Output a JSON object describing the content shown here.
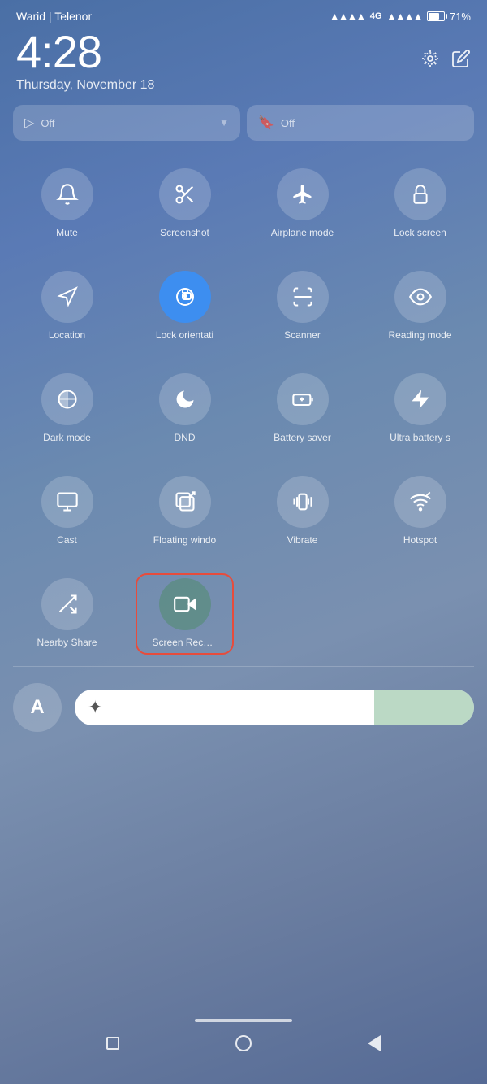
{
  "statusBar": {
    "carrier": "Warid | Telenor",
    "network": "4G",
    "batteryPercent": "71%"
  },
  "clock": {
    "time": "4:28",
    "date": "Thursday, November 18"
  },
  "quickTiles": [
    {
      "id": "location",
      "label": "Location",
      "icon": "location",
      "active": false
    },
    {
      "id": "lock-orientation",
      "label": "Lock orientati",
      "icon": "lock-rotate",
      "active": true
    },
    {
      "id": "scanner",
      "label": "Scanner",
      "icon": "scanner",
      "active": false
    },
    {
      "id": "reading-mode",
      "label": "Reading mode",
      "icon": "eye",
      "active": false
    },
    {
      "id": "dark-mode",
      "label": "Dark mode",
      "icon": "dark",
      "active": false
    },
    {
      "id": "dnd",
      "label": "DND",
      "icon": "moon",
      "active": false
    },
    {
      "id": "battery-saver",
      "label": "Battery saver",
      "icon": "battery-plus",
      "active": false
    },
    {
      "id": "ultra-battery",
      "label": "Ultra battery s",
      "icon": "lightning",
      "active": false
    },
    {
      "id": "cast",
      "label": "Cast",
      "icon": "cast",
      "active": false
    },
    {
      "id": "floating-window",
      "label": "Floating windo",
      "icon": "floating",
      "active": false
    },
    {
      "id": "vibrate",
      "label": "Vibrate",
      "icon": "vibrate",
      "active": false
    },
    {
      "id": "hotspot",
      "label": "Hotspot",
      "icon": "hotspot",
      "active": false
    },
    {
      "id": "nearby-share",
      "label": "Nearby Share",
      "icon": "shuffle",
      "active": false
    },
    {
      "id": "screen-record",
      "label": "Screen Recor…",
      "icon": "video",
      "active": false,
      "highlighted": true
    }
  ],
  "topTiles": [
    {
      "id": "top-left",
      "label": "Off",
      "icon": "arrow"
    },
    {
      "id": "top-right",
      "label": "Off",
      "icon": "bookmark"
    }
  ],
  "topRow": [
    {
      "id": "mute",
      "label": "Mute",
      "icon": "bell"
    },
    {
      "id": "screenshot",
      "label": "Screenshot",
      "icon": "scissors"
    },
    {
      "id": "airplane",
      "label": "Airplane mode",
      "icon": "plane"
    },
    {
      "id": "lock-screen",
      "label": "Lock screen",
      "icon": "lock"
    }
  ],
  "brightness": {
    "level": 75,
    "fontLabel": "A"
  },
  "nav": {
    "pill": true,
    "buttons": [
      "square",
      "circle",
      "triangle"
    ]
  }
}
